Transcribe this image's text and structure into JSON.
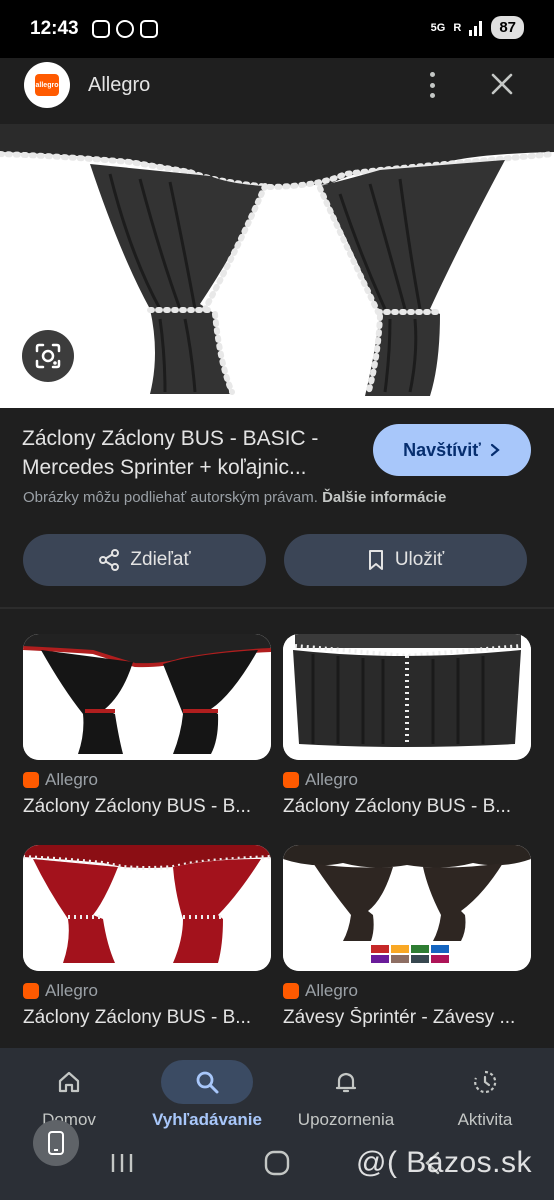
{
  "status_bar": {
    "time": "12:43",
    "network": "5G",
    "signal_label": "R",
    "battery": "87"
  },
  "header": {
    "app_name": "Allegro",
    "logo_text": "allegro"
  },
  "hero": {
    "alt": "Záclony BUS - BASIC curtains"
  },
  "result": {
    "title": "Záclony Záclony BUS - BASIC - Mercedes Sprinter + koľajnic...",
    "visit_label": "Navštíviť",
    "copyright_text": "Obrázky môžu podliehať autorským právam.",
    "more_info": "Ďalšie informácie",
    "share_label": "Zdieľať",
    "save_label": "Uložiť"
  },
  "related": [
    {
      "source": "Allegro",
      "title": "Záclony Záclony BUS - B...",
      "variant": "black-red"
    },
    {
      "source": "Allegro",
      "title": "Záclony Záclony BUS - B...",
      "variant": "black-white-full"
    },
    {
      "source": "Allegro",
      "title": "Záclony Záclony BUS - B...",
      "variant": "red-white"
    },
    {
      "source": "Allegro",
      "title": "Závesy Šprintér - Závesy ...",
      "variant": "brown-swatches"
    }
  ],
  "bottom_nav": [
    {
      "label": "Domov",
      "icon": "home-icon",
      "active": false
    },
    {
      "label": "Vyhľadávanie",
      "icon": "search-icon",
      "active": true
    },
    {
      "label": "Upozornenia",
      "icon": "bell-icon",
      "active": false
    },
    {
      "label": "Aktivita",
      "icon": "activity-icon",
      "active": false
    }
  ],
  "watermark": "@( Bazos.sk",
  "colors": {
    "accent": "#a8c7fa",
    "background": "#1f1f1f",
    "brand": "#ff5a00"
  }
}
